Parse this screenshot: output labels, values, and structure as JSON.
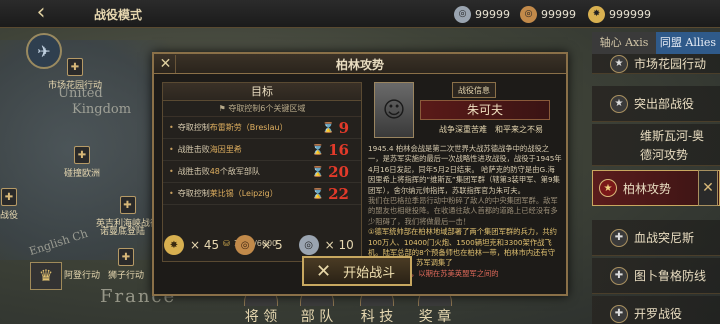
{
  "topbar": {
    "back_icon": "‹",
    "title": "战役模式",
    "resources": [
      {
        "icon": "silver-medal-icon",
        "value": "99999",
        "color": "#9aa4b0"
      },
      {
        "icon": "bronze-medal-icon",
        "value": "99999",
        "color": "#c28a4a"
      },
      {
        "icon": "gold-star-icon",
        "value": "999999",
        "color": "#d8b050"
      }
    ]
  },
  "map": {
    "labels": [
      {
        "text": "United",
        "size": 13
      },
      {
        "text": "Kingdom",
        "size": 13
      },
      {
        "text": "English Ch",
        "size": 11
      },
      {
        "text": "France",
        "size": 18
      }
    ],
    "pins": [
      {
        "text": "市场花园行动"
      },
      {
        "text": "碰撞欧洲"
      },
      {
        "text": "英吉利海峡战役"
      },
      {
        "text": "诺曼底登陆"
      },
      {
        "text": "狮子行动"
      },
      {
        "text": "阿登行动"
      },
      {
        "text": "战役"
      }
    ]
  },
  "right_panel": {
    "tab_axis": "轴心 Axis",
    "tab_allies": "同盟 Allies",
    "items": [
      {
        "label": "市场花园行动",
        "icon": "star-icon",
        "active": false
      },
      {
        "label": "突出部战役",
        "icon": "star-icon",
        "active": false
      },
      {
        "label": "维斯瓦河-奥",
        "icon": "star-icon",
        "active": false
      },
      {
        "label": "德河攻势",
        "icon": "",
        "active": false
      },
      {
        "label": "柏林攻势",
        "icon": "star-icon",
        "active": true
      },
      {
        "label": "血战突尼斯",
        "icon": "cross-icon",
        "active": false
      },
      {
        "label": "图卜鲁格防线",
        "icon": "cross-icon",
        "active": false
      },
      {
        "label": "开罗战役",
        "icon": "cross-icon",
        "active": false
      }
    ],
    "close_icon": "✕"
  },
  "bottom_nav": [
    {
      "label": "将 领"
    },
    {
      "label": "部 队"
    },
    {
      "label": "科 技"
    },
    {
      "label": "奖 章"
    }
  ],
  "modal": {
    "title": "柏林攻势",
    "close_icon": "✕",
    "objectives": {
      "heading": "目标",
      "subtitle": "夺取控制6个关键区域",
      "tasks": [
        {
          "prefix": "夺取控制",
          "highlight": "布雷斯劳（Breslau）",
          "suffix": "",
          "turns": "9"
        },
        {
          "prefix": "战胜击败",
          "highlight": "海因里希",
          "suffix": "",
          "turns": "16"
        },
        {
          "prefix": "战胜击败",
          "highlight": "48",
          "suffix": "个敌军部队",
          "turns": "20"
        },
        {
          "prefix": "夺取控制",
          "highlight": "莱比锡（Leipzig）",
          "suffix": "",
          "turns": "22"
        }
      ],
      "progress": "1200/6000"
    },
    "rewards": [
      {
        "icon": "gold-star-medal-icon",
        "value": "× 45",
        "color": "#d8b050"
      },
      {
        "icon": "bronze-medal-icon",
        "value": "× 5",
        "color": "#c28a4a"
      },
      {
        "icon": "silver-medal-icon",
        "value": "× 10",
        "color": "#9aa4b0"
      }
    ],
    "info": {
      "tag": "战役信息",
      "general_name": "朱可夫",
      "trait_1": "战争深重苦难",
      "trait_2": "和平来之不易",
      "paragraph_1": "1945.4 柏林会战是第二次世界大战苏德战争中的战役之一，是苏军实施的最后一次战略性进攻战役，战役于1945年4月16日发起，同年5月2日结束。 哈萨克的防守是由G.海因里希上将指挥的“维斯瓦”集团军群（辖第3装甲军、第9集团军），舍尔纳元帅指挥，苏联指挥官为朱可夫。",
      "paragraph_2": "我们在巴格拉季昂行动中粉碎了敌人的中央集团军群。敌军的盟友也相继投降。在收通往敌人首都的道路上已经没有多少阻碍了，我们将做最后一击！",
      "paragraph_3": "①德军统帅部在柏林地域部署了两个集团军群的兵力，共约100万人、10400门火炮、1500辆坦克和3300架作战飞机。陆军总部的8个预备师也在柏林一带，柏林市内还有守备队20万人。 苏军调集了",
      "paragraph_4": "①时坚守柏林，以期在苏美英盟军之间的"
    },
    "start_icon": "✕",
    "start_label": "开始战斗"
  }
}
